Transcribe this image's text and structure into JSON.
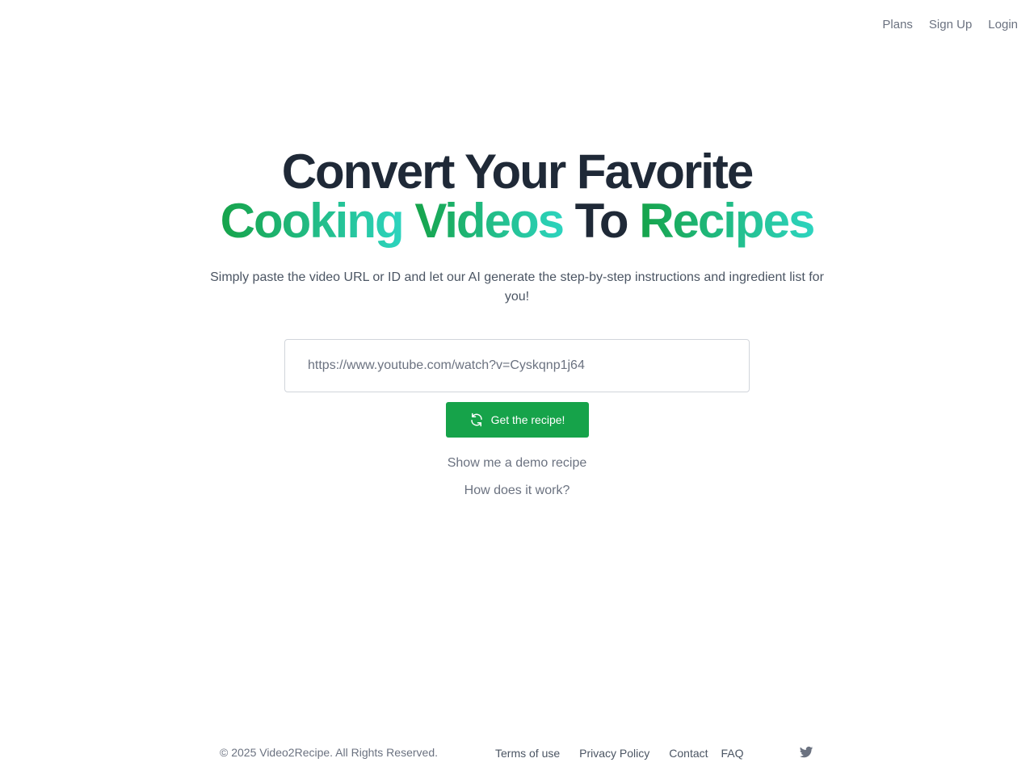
{
  "nav": {
    "plans": "Plans",
    "signup": "Sign Up",
    "login": "Login"
  },
  "hero": {
    "line1": "Convert Your Favorite",
    "cooking": "Cooking",
    "videos": "Videos",
    "to": "To",
    "recipes": "Recipes",
    "subtitle": "Simply paste the video URL or ID and let our AI generate the step-by-step instructions and ingredient list for you!"
  },
  "form": {
    "url_placeholder": "https://www.youtube.com/watch?v=Cyskqnp1j64",
    "url_value": "",
    "submit_label": "Get the recipe!",
    "submit_icon": "refresh-icon"
  },
  "links": {
    "demo": "Show me a demo recipe",
    "how": "How does it work?"
  },
  "footer": {
    "copyright": "© 2025 Video2Recipe. All Rights Reserved.",
    "terms": "Terms of use",
    "privacy": "Privacy Policy",
    "contact": "Contact",
    "faq": "FAQ",
    "social_icon": "twitter-icon"
  },
  "colors": {
    "brand_green": "#16a34a",
    "gradient_end": "#2dd4bf",
    "text_dark": "#1f2937",
    "text_muted": "#6b7280"
  }
}
